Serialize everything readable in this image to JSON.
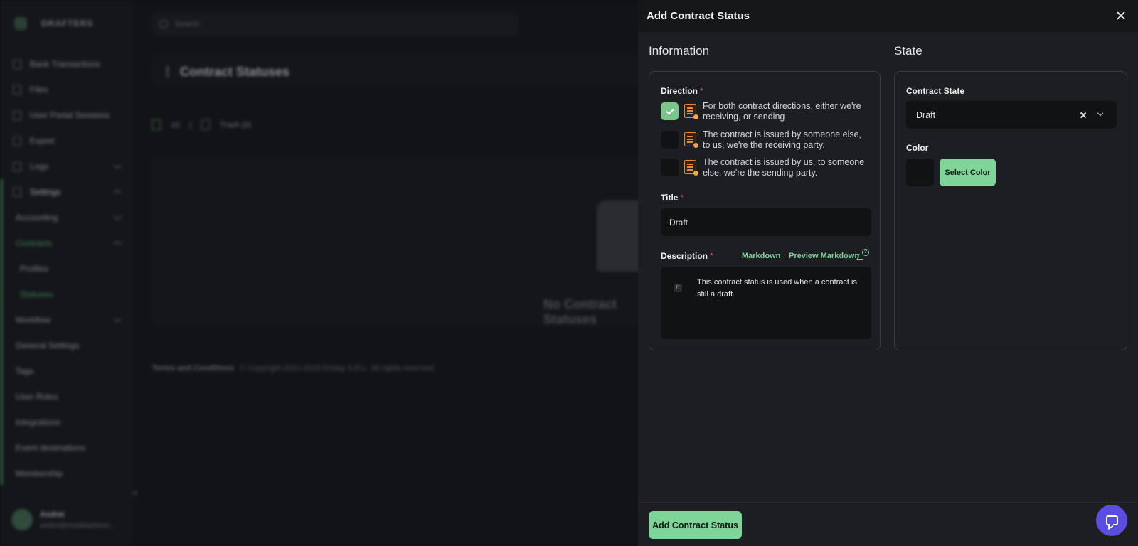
{
  "background": {
    "brand": "DRAFTERS",
    "search_placeholder": "Search",
    "page_title": "Contract Statuses",
    "toolbar": {
      "count": "10",
      "trash_label": "Trash (0)"
    },
    "empty_state": "No Contract Statuses",
    "footer": {
      "terms": "Terms and Conditions",
      "copyright": "© Copyright 2021-2026 Eriday S.R.L. All rights reserved."
    },
    "user": {
      "name": "Andrei",
      "email": "andrei@emailaddress..."
    },
    "sidebar": {
      "items": [
        {
          "label": "Bank Transactions"
        },
        {
          "label": "Files"
        },
        {
          "label": "User Portal Sessions"
        },
        {
          "label": "Export"
        },
        {
          "label": "Logs"
        },
        {
          "label": "Settings"
        },
        {
          "label": "Accounting"
        },
        {
          "label": "Contracts"
        },
        {
          "label": "Profiles"
        },
        {
          "label": "Statuses"
        },
        {
          "label": "Workflow"
        },
        {
          "label": "General Settings"
        },
        {
          "label": "Tags"
        },
        {
          "label": "User Roles"
        },
        {
          "label": "Integrations"
        },
        {
          "label": "Event destinations"
        },
        {
          "label": "Membership"
        }
      ]
    }
  },
  "drawer": {
    "title": "Add Contract Status",
    "information": {
      "heading": "Information",
      "direction": {
        "label": "Direction",
        "required_mark": "*",
        "options": [
          {
            "text": "For both contract directions, either we're receiving, or sending",
            "checked": true
          },
          {
            "text": "The contract is issued by someone else, to us, we're the receiving party.",
            "checked": false
          },
          {
            "text": "The contract is issued by us, to someone else, we're the sending party.",
            "checked": false
          }
        ]
      },
      "title": {
        "label": "Title",
        "required_mark": "*",
        "value": "Draft"
      },
      "description": {
        "label": "Description",
        "required_mark": "*",
        "markdown_link": "Markdown",
        "preview_link": "Preview Markdown",
        "block_tag": "P",
        "value": "This contract status is used when a contract is still a draft."
      }
    },
    "state": {
      "heading": "State",
      "contract_state": {
        "label": "Contract State",
        "value": "Draft"
      },
      "color": {
        "label": "Color",
        "button": "Select Color",
        "swatch": "#111214"
      }
    },
    "submit_label": "Add Contract Status"
  },
  "colors": {
    "accent": "#7fd49a",
    "required": "#d9534f",
    "chat": "#5a4ee0",
    "icon_orange": "#e48a3a"
  },
  "icons": [
    "close-icon",
    "checkmark-icon",
    "contract-document-icon",
    "clear-icon",
    "chevron-down-icon",
    "markdown-help-icon",
    "chat-icon"
  ]
}
